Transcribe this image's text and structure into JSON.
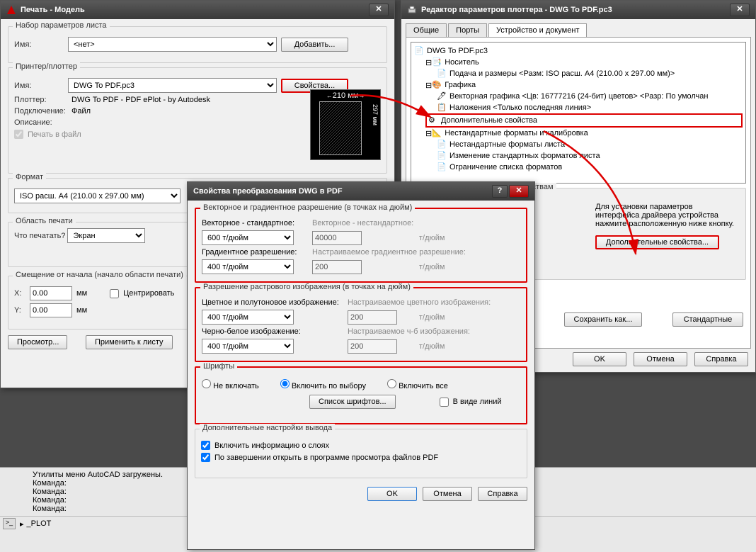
{
  "print_window": {
    "title": "Печать - Модель",
    "pageset": {
      "legend": "Набор параметров листа",
      "name_label": "Имя:",
      "name_value": "<нет>",
      "add_btn": "Добавить..."
    },
    "printer": {
      "legend": "Принтер/плоттер",
      "name_label": "Имя:",
      "name_value": "DWG To PDF.pc3",
      "properties_btn": "Свойства...",
      "plotter_label": "Плоттер:",
      "plotter_value": "DWG To PDF - PDF ePlot - by Autodesk",
      "connection_label": "Подключение:",
      "connection_value": "Файл",
      "description_label": "Описание:",
      "print_to_file": "Печать в файл",
      "preview_dim": "210 мм",
      "preview_dim2": "297 мм"
    },
    "format": {
      "legend": "Формат",
      "value": "ISO расш. A4 (210.00 x 297.00 мм)"
    },
    "area": {
      "legend": "Область печати",
      "what_label": "Что печатать?",
      "what_value": "Экран"
    },
    "offset": {
      "legend": "Смещение от начала (начало области печати)",
      "x_label": "X:",
      "x_value": "0.00",
      "y_label": "Y:",
      "y_value": "0.00",
      "unit": "мм",
      "center": "Центрировать"
    },
    "preview_btn": "Просмотр...",
    "apply_btn": "Применить к листу"
  },
  "plotter_window": {
    "title": "Редактор параметров плоттера - DWG To PDF.pc3",
    "tabs": {
      "general": "Общие",
      "ports": "Порты",
      "device": "Устройство и документ"
    },
    "tree": {
      "root": "DWG To PDF.pc3",
      "media": "Носитель",
      "feed": "Подача и размеры <Разм: ISO расш. A4 (210.00 x 297.00 мм)>",
      "graphics": "Графика",
      "vector": "Векторная графика <Цв: 16777216 (24-бит) цветов> <Разр: По умолчан",
      "overlay": "Наложения <Только последняя линия>",
      "custom_props": "Дополнительные свойства",
      "nonstd": "Нестандартные форматы и калибровка",
      "nonstd_formats": "Нестандартные форматы листа",
      "change_formats": "Изменение стандартных форматов листа",
      "limit_formats": "Ограничение списка форматов"
    },
    "access": {
      "legend": "Доступ к дополнительным свойствам",
      "text": "Для установки параметров интерфейса драйвера устройства нажмите расположенную ниже кнопку.",
      "btn": "Дополнительные свойства..."
    },
    "save_as": "Сохранить как...",
    "defaults": "Стандартные",
    "ok": "OK",
    "cancel": "Отмена",
    "help": "Справка"
  },
  "pdf_window": {
    "title": "Свойства преобразования DWG в PDF",
    "vector_group": {
      "legend": "Векторное и градиентное разрешение (в точках на дюйм)",
      "vec_std_label": "Векторное - стандартное:",
      "vec_std_value": "600 т/дюйм",
      "vec_nonstd_label": "Векторное - нестандартное:",
      "vec_nonstd_value": "40000",
      "grad_label": "Градиентное разрешение:",
      "grad_value": "400 т/дюйм",
      "grad_nonstd_label": "Настраиваемое градиентное разрешение:",
      "grad_nonstd_value": "200",
      "unit": "т/дюйм"
    },
    "raster_group": {
      "legend": "Разрешение растрового изображения (в точках на дюйм)",
      "color_label": "Цветное и полутоновое изображение:",
      "color_value": "400 т/дюйм",
      "color_nonstd_label": "Настраиваемое цветного изображения:",
      "color_nonstd_value": "200",
      "bw_label": "Черно-белое изображение:",
      "bw_value": "400 т/дюйм",
      "bw_nonstd_label": "Настраиваемое ч-б изображения:",
      "bw_nonstd_value": "200",
      "unit": "т/дюйм"
    },
    "fonts_group": {
      "legend": "Шрифты",
      "none": "Не включать",
      "by_choice": "Включить по выбору",
      "all": "Включить все",
      "font_list_btn": "Список шрифтов...",
      "as_lines": "В виде линий"
    },
    "output": {
      "legend": "Дополнительные настройки вывода",
      "layers": "Включить информацию о слоях",
      "open_after": "По завершении открыть в программе просмотра файлов PDF"
    },
    "ok": "OK",
    "cancel": "Отмена",
    "help": "Справка"
  },
  "console": {
    "line1": "Утилиты меню AutoCAD загружены.",
    "line2": "Команда:",
    "line3": "Команда:",
    "line4": "Команда:",
    "line5": "Команда:",
    "cmd": "_PLOT"
  }
}
